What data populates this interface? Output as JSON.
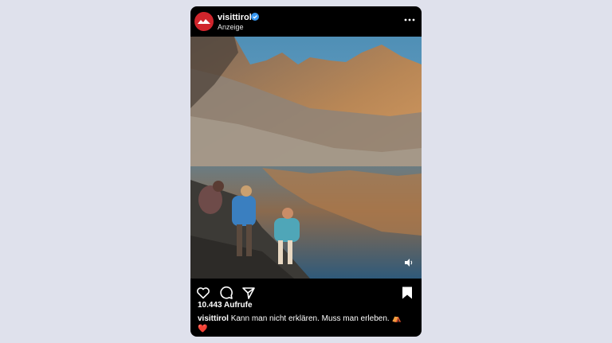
{
  "post": {
    "username": "visittirol",
    "verified": true,
    "sponsored_label": "Anzeige",
    "views": "10.443 Aufrufe",
    "caption_user": "visittirol",
    "caption_text": "Kann man nicht erklären. Muss man erleben. ⛺",
    "caption_emoji": "❤️"
  },
  "icons": {
    "avatar": "tirol-logo",
    "verified": "verified-badge-icon",
    "more": "more-options-icon",
    "volume": "volume-icon",
    "like": "heart-icon",
    "comment": "comment-icon",
    "share": "send-icon",
    "save": "bookmark-icon"
  },
  "colors": {
    "page_background": "#dfe1ec",
    "card_background": "#000000",
    "brand_red": "#d0252c",
    "verified_blue": "#3897f0"
  }
}
